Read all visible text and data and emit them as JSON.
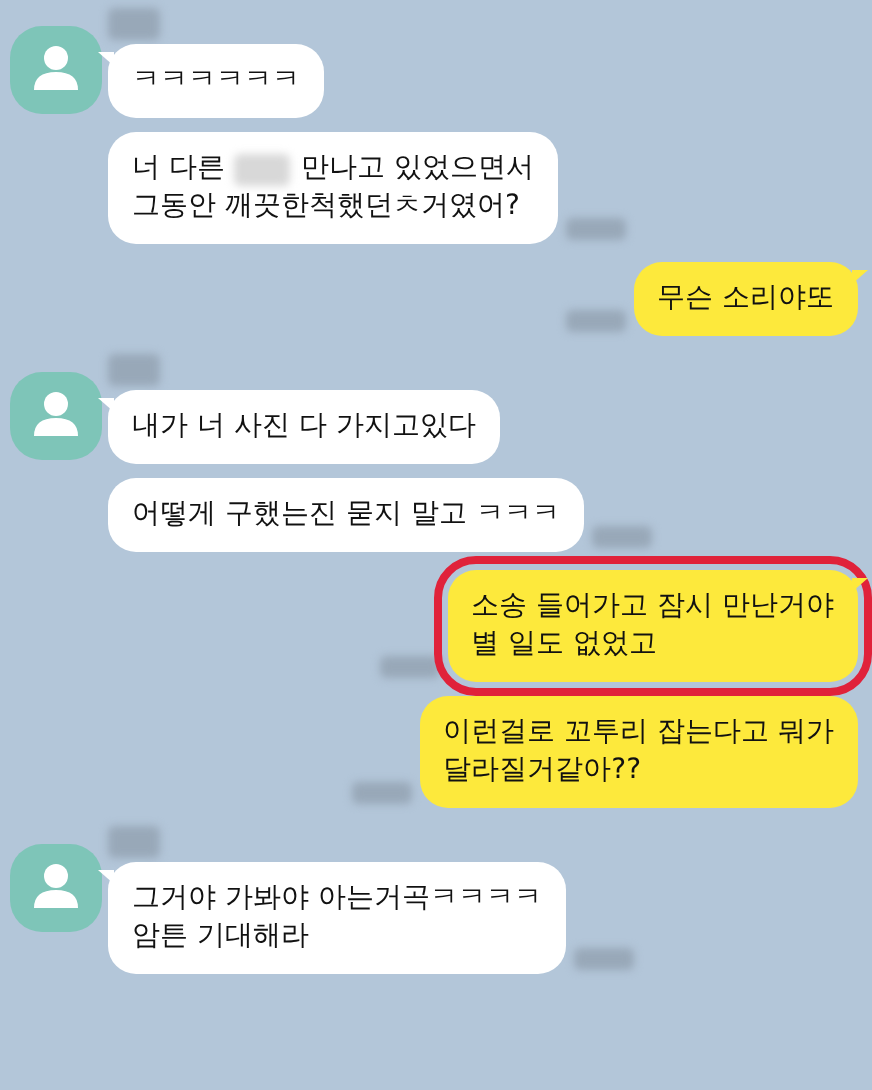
{
  "groups": [
    {
      "kind": "incoming",
      "name_redacted": true,
      "messages": [
        {
          "lines": [
            [
              {
                "kind": "text",
                "text": "ㅋㅋㅋㅋㅋㅋ"
              }
            ]
          ],
          "time_redacted": false,
          "highlighted": false
        },
        {
          "lines": [
            [
              {
                "kind": "text",
                "text": "너 다른"
              },
              {
                "kind": "redacted"
              },
              {
                "kind": "text",
                "text": "만나고 있었으면서"
              }
            ],
            [
              {
                "kind": "text",
                "text": "그동안 깨끗한척했던ㅊ거였어?"
              }
            ]
          ],
          "time_redacted": true,
          "highlighted": false
        }
      ]
    },
    {
      "kind": "outgoing",
      "messages": [
        {
          "lines": [
            [
              {
                "kind": "text",
                "text": "무슨 소리야또"
              }
            ]
          ],
          "time_redacted": true,
          "highlighted": false
        }
      ]
    },
    {
      "kind": "incoming",
      "name_redacted": true,
      "messages": [
        {
          "lines": [
            [
              {
                "kind": "text",
                "text": "내가 너 사진 다 가지고있다"
              }
            ]
          ],
          "time_redacted": false,
          "highlighted": false
        },
        {
          "lines": [
            [
              {
                "kind": "text",
                "text": "어떻게 구했는진 묻지 말고 ㅋㅋㅋ"
              }
            ]
          ],
          "time_redacted": true,
          "highlighted": false
        }
      ]
    },
    {
      "kind": "outgoing",
      "messages": [
        {
          "lines": [
            [
              {
                "kind": "text",
                "text": "소송 들어가고 잠시 만난거야"
              }
            ],
            [
              {
                "kind": "text",
                "text": "별 일도 없었고"
              }
            ]
          ],
          "time_redacted": true,
          "highlighted": true
        },
        {
          "lines": [
            [
              {
                "kind": "text",
                "text": "이런걸로 꼬투리 잡는다고 뭐가"
              }
            ],
            [
              {
                "kind": "text",
                "text": "달라질거같아??"
              }
            ]
          ],
          "time_redacted": true,
          "highlighted": false
        }
      ]
    },
    {
      "kind": "incoming",
      "name_redacted": true,
      "messages": [
        {
          "lines": [
            [
              {
                "kind": "text",
                "text": "그거야 가봐야 아는거곡ㅋㅋㅋㅋ"
              }
            ],
            [
              {
                "kind": "text",
                "text": "암튼 기대해라"
              }
            ]
          ],
          "time_redacted": true,
          "highlighted": false
        }
      ]
    }
  ]
}
